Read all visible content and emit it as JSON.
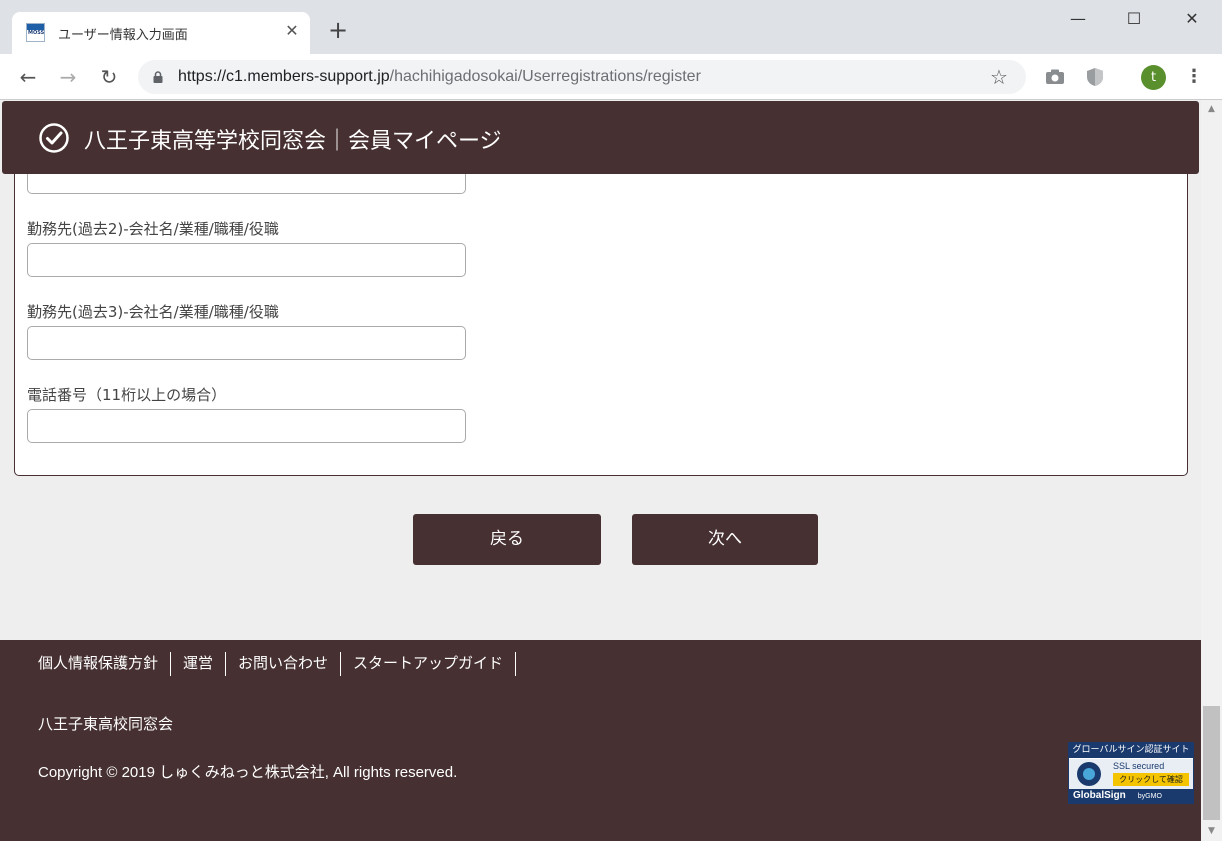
{
  "browser": {
    "tab_title": "ユーザー情報入力画面",
    "tab_close": "✕",
    "new_tab": "+",
    "favicon_text": "MOSS",
    "url_host": "https://c1.members-support.jp",
    "url_path": "/hachihigadosokai/Userregistrations/register",
    "avatar_letter": "t",
    "window_controls": {
      "minimize": "—",
      "maximize": "☐",
      "close": "✕"
    },
    "nav": {
      "back": "←",
      "forward": "→",
      "reload": "↻"
    },
    "star": "☆",
    "menu": "⋮"
  },
  "header": {
    "site_title": "八王子東高等学校同窓会｜会員マイページ"
  },
  "form": {
    "fields": [
      {
        "label": "勤務先(過去2)-会社名/業種/職種/役職",
        "value": ""
      },
      {
        "label": "勤務先(過去3)-会社名/業種/職種/役職",
        "value": ""
      },
      {
        "label": "電話番号（11桁以上の場合）",
        "value": ""
      }
    ],
    "back_label": "戻る",
    "next_label": "次へ"
  },
  "footer": {
    "links": [
      "個人情報保護方針",
      "運営",
      "お問い合わせ",
      "スタートアップガイド"
    ],
    "org": "八王子東高校同窓会",
    "copyright": "Copyright © 2019 しゅくみねっと株式会社, All rights reserved."
  },
  "seal": {
    "top": "グローバルサイン認証サイト",
    "ssl": "SSL secured",
    "click": "クリックして確認",
    "brand": "GlobalSign",
    "by": "byGMO"
  },
  "colors": {
    "brand": "#463032",
    "page_bg": "#eeeeee"
  }
}
